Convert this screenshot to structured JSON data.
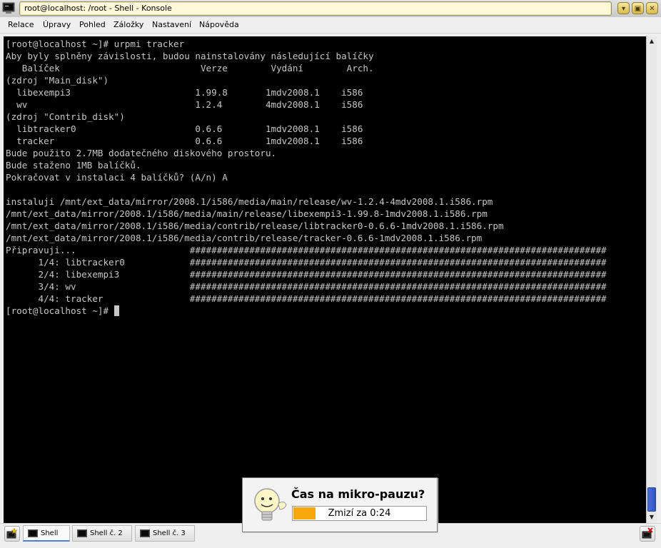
{
  "window": {
    "title": "root@localhost: /root - Shell - Konsole"
  },
  "menu": [
    "Relace",
    "Úpravy",
    "Pohled",
    "Záložky",
    "Nastavení",
    "Nápověda"
  ],
  "terminal": {
    "lines": [
      "[root@localhost ~]# urpmi tracker",
      "Aby byly splněny závislosti, budou nainstalovány následující balíčky",
      "   Balíček                          Verze        Vydání        Arch.",
      "(zdroj \"Main_disk\")",
      "  libexempi3                       1.99.8       1mdv2008.1    i586",
      "  wv                               1.2.4        4mdv2008.1    i586",
      "(zdroj \"Contrib_disk\")",
      "  libtracker0                      0.6.6        1mdv2008.1    i586",
      "  tracker                          0.6.6        1mdv2008.1    i586",
      "Bude použito 2.7MB dodatečného diskového prostoru.",
      "Bude staženo 1MB balíčků.",
      "Pokračovat v instalaci 4 balíčků? (A/n) A",
      "",
      "instaluji /mnt/ext_data/mirror/2008.1/i586/media/main/release/wv-1.2.4-4mdv2008.1.i586.rpm",
      "/mnt/ext_data/mirror/2008.1/i586/media/main/release/libexempi3-1.99.8-1mdv2008.1.i586.rpm",
      "/mnt/ext_data/mirror/2008.1/i586/media/contrib/release/libtracker0-0.6.6-1mdv2008.1.i586.rpm",
      "/mnt/ext_data/mirror/2008.1/i586/media/contrib/release/tracker-0.6.6-1mdv2008.1.i586.rpm",
      "Připravuji...                     #############################################################################",
      "      1/4: libtracker0            #############################################################################",
      "      2/4: libexempi3             #############################################################################",
      "      3/4: wv                     #############################################################################",
      "      4/4: tracker                #############################################################################"
    ],
    "prompt": "[root@localhost ~]# "
  },
  "tabs": [
    {
      "label": "Shell",
      "active": true
    },
    {
      "label": "Shell č. 2",
      "active": false
    },
    {
      "label": "Shell č. 3",
      "active": false
    }
  ],
  "popup": {
    "title": "Čas na mikro-pauzu?",
    "countdown_label": "Zmizí za 0:24",
    "countdown_progress": 0.17,
    "countdown_color": "#f7a80e"
  },
  "colors": {
    "terminal_bg": "#000000",
    "terminal_fg": "#c6c6c6",
    "title_field": "#fdf8d8",
    "scroll_thumb": "#2f52c4"
  }
}
